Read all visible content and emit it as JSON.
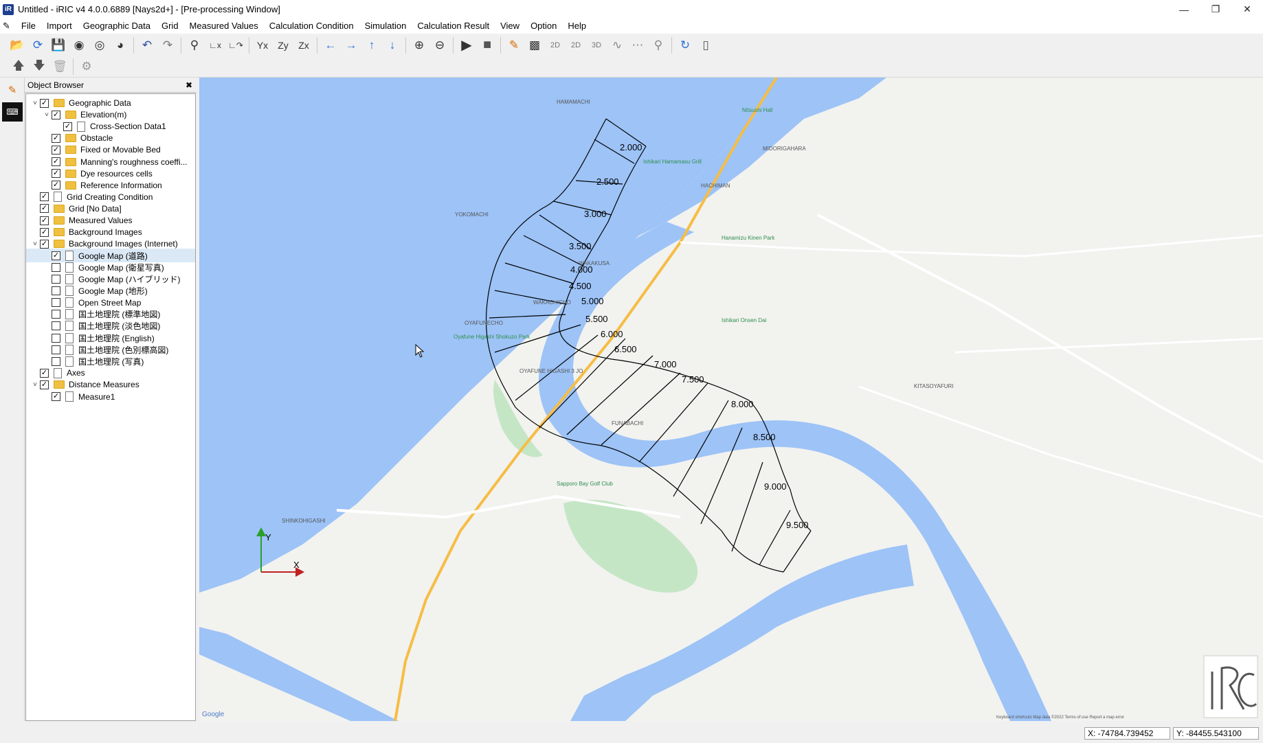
{
  "window": {
    "title": "Untitled - iRIC v4 4.0.0.6889 [Nays2d+] - [Pre-processing Window]",
    "app_icon": "iric-logo-icon",
    "controls": [
      "minimize-icon",
      "restore-icon",
      "close-icon"
    ]
  },
  "menu": [
    "File",
    "Import",
    "Geographic Data",
    "Grid",
    "Measured Values",
    "Calculation Condition",
    "Simulation",
    "Calculation Result",
    "View",
    "Option",
    "Help"
  ],
  "object_browser": {
    "title": "Object Browser",
    "items": [
      {
        "label": "Geographic Data",
        "checked": true,
        "icon": "folder-icon",
        "expanded": true
      },
      {
        "label": "Elevation(m)",
        "checked": true,
        "icon": "folder-icon",
        "expanded": true
      },
      {
        "label": "Cross-Section Data1",
        "checked": true,
        "icon": "document-icon"
      },
      {
        "label": "Obstacle",
        "checked": true,
        "icon": "folder-icon"
      },
      {
        "label": "Fixed or Movable Bed",
        "checked": true,
        "icon": "folder-icon"
      },
      {
        "label": "Manning's roughness coeffi...",
        "checked": true,
        "icon": "folder-icon"
      },
      {
        "label": "Dye resources cells",
        "checked": true,
        "icon": "folder-icon"
      },
      {
        "label": "Reference Information",
        "checked": true,
        "icon": "folder-icon"
      },
      {
        "label": "Grid Creating Condition",
        "checked": true,
        "icon": "document-icon"
      },
      {
        "label": "Grid [No Data]",
        "checked": true,
        "icon": "folder-icon"
      },
      {
        "label": "Measured Values",
        "checked": true,
        "icon": "folder-icon"
      },
      {
        "label": "Background Images",
        "checked": true,
        "icon": "folder-icon"
      },
      {
        "label": "Background Images (Internet)",
        "checked": true,
        "icon": "folder-icon",
        "expanded": true
      },
      {
        "label": "Google Map (道路)",
        "checked": true,
        "icon": "document-icon",
        "selected": true
      },
      {
        "label": "Google Map (衛星写真)",
        "checked": false,
        "icon": "document-icon"
      },
      {
        "label": "Google Map (ハイブリッド)",
        "checked": false,
        "icon": "document-icon"
      },
      {
        "label": "Google Map (地形)",
        "checked": false,
        "icon": "document-icon"
      },
      {
        "label": "Open Street Map",
        "checked": false,
        "icon": "document-icon"
      },
      {
        "label": "国土地理院 (標準地図)",
        "checked": false,
        "icon": "document-icon"
      },
      {
        "label": "国土地理院 (淡色地図)",
        "checked": false,
        "icon": "document-icon"
      },
      {
        "label": "国土地理院 (English)",
        "checked": false,
        "icon": "document-icon"
      },
      {
        "label": "国土地理院 (色別標高図)",
        "checked": false,
        "icon": "document-icon"
      },
      {
        "label": "国土地理院 (写真)",
        "checked": false,
        "icon": "document-icon"
      },
      {
        "label": "Axes",
        "checked": true,
        "icon": "document-icon"
      },
      {
        "label": "Distance Measures",
        "checked": true,
        "icon": "folder-icon",
        "expanded": true
      },
      {
        "label": "Measure1",
        "checked": true,
        "icon": "document-icon"
      }
    ]
  },
  "map": {
    "cross_section_labels": [
      "2.000",
      "2.500",
      "3.000",
      "3.500",
      "4.000",
      "4.500",
      "5.000",
      "5.500",
      "6.000",
      "6.500",
      "7.000",
      "7.500",
      "8.000",
      "8.500",
      "9.000",
      "9.500"
    ],
    "place_labels": [
      "HAMAMACHI",
      "MIDORIGAHARA",
      "YOKOMACHI",
      "WAKAKUSA",
      "WAKACHICHO",
      "OYAFUNECHO",
      "OYAFUNE HIGASHI 3 JO",
      "FUNABACHI",
      "KITASOYAFURI",
      "SHINKOHIGASHI",
      "HACHIMAN"
    ],
    "poi_labels": [
      "Ishikari Hamamasu Grill",
      "Nitsushi Hall",
      "Sapporo Bay Golf Club",
      "Hanamizu Kinen Park",
      "Oyafune Higashi Shokuzo Park",
      "Ishikari Onsen Dai"
    ],
    "axis_x_label": "X",
    "axis_y_label": "Y",
    "google_label": "Google",
    "attribution": "Keyboard shortcuts  Map data ©2022  Terms of use  Report a map error",
    "colors": {
      "water": "#9dc3f7",
      "land": "#f2f2ef",
      "road": "#f6bd45",
      "park": "#c5e6c5",
      "grid": "#000000"
    }
  },
  "status": {
    "x": "X: -74784.739452",
    "y": "Y: -84455.543100"
  }
}
